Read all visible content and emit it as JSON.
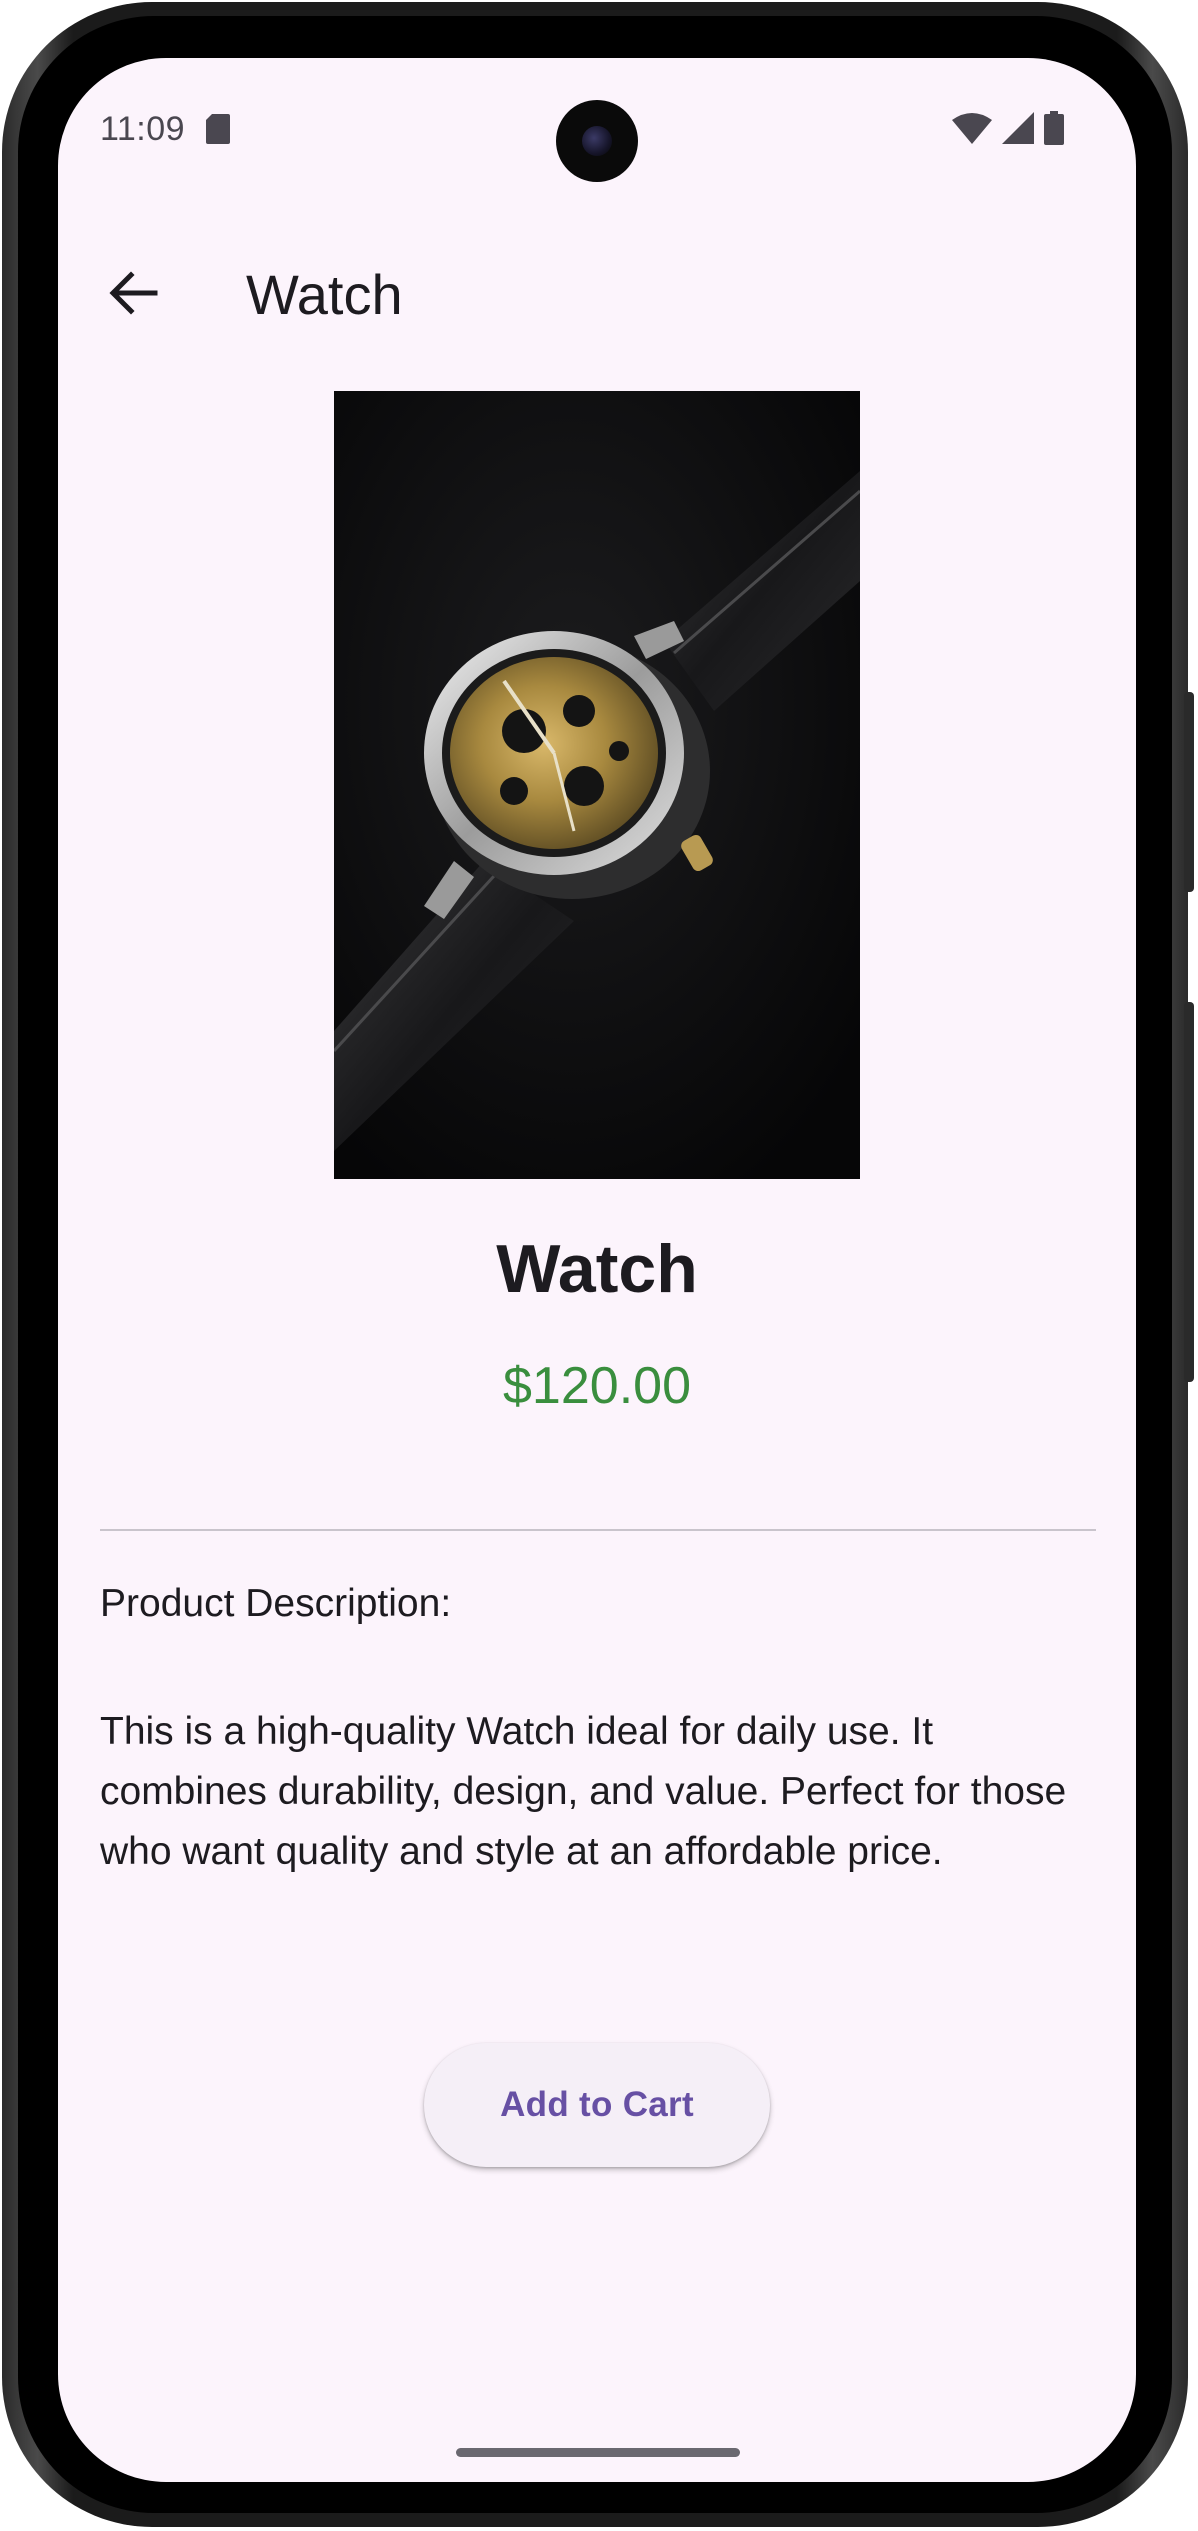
{
  "status_bar": {
    "time": "11:09",
    "icons": [
      "sd-card-icon",
      "wifi-icon",
      "cell-signal-icon",
      "battery-icon"
    ]
  },
  "app_bar": {
    "back_icon": "arrow-back-icon",
    "title": "Watch"
  },
  "product": {
    "image_alt": "watch-photo",
    "name": "Watch",
    "price": "$120.00",
    "description_heading": "Product Description:",
    "description": "This is a high-quality Watch ideal for daily use. It combines durability, design, and value. Perfect for those who want quality and style at an affordable price."
  },
  "actions": {
    "add_to_cart": "Add to Cart"
  },
  "colors": {
    "background": "#fcf4fc",
    "price": "#3a8e3e",
    "button_text": "#6750a4",
    "button_bg": "#f5eff7"
  }
}
